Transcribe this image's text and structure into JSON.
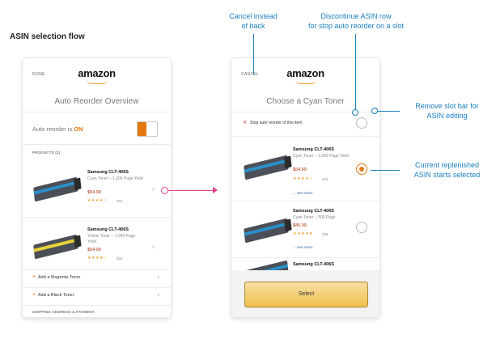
{
  "page": {
    "title": "ASIN selection flow"
  },
  "left_screen": {
    "nav_label": "DONE",
    "logo": "amazon",
    "title": "Auto Reorder Overview",
    "auto_reorder_label": "Auto reorder is",
    "auto_reorder_state": "ON",
    "products_label": "PRODUCTS (2)",
    "products": [
      {
        "name": "Samsung CLT-406S",
        "desc": "Cyan Toner – 1,000 Page Yield",
        "price": "$54.99",
        "stars": "★★★★☆",
        "reviews": "324",
        "color": "#2a8fc9"
      },
      {
        "name": "Samsung CLT-406S",
        "desc": "Yellow Toner – 1,000 Page Yield",
        "price": "$54.99",
        "stars": "★★★★☆",
        "reviews": "324",
        "color": "#e8d23a"
      }
    ],
    "add_items": [
      {
        "label": "Add a Magenta Toner"
      },
      {
        "label": "Add a Black Toner"
      }
    ],
    "shipping_label": "SHIPPING ADDRESS & PAYMENT"
  },
  "right_screen": {
    "nav_label": "CANCEL",
    "logo": "amazon",
    "title": "Choose a Cyan Toner",
    "stop_label": "Stop auto reorder of this item",
    "options": [
      {
        "name": "Samsung CLT-406S",
        "desc": "Cyan Toner – 1,000 Page Yield",
        "price": "$54.99",
        "stars": "★★★★☆",
        "reviews": "324",
        "see_more": "See More",
        "selected": true
      },
      {
        "name": "Samsung CLT-406S",
        "desc": "Cyan Toner – 500 Page",
        "price": "$45.99",
        "stars": "★★★★★",
        "reviews": "236",
        "see_more": "See More",
        "selected": false
      },
      {
        "name": "Samsung CLT-406S",
        "desc": "",
        "price": "",
        "stars": "",
        "reviews": "",
        "see_more": "",
        "selected": false
      }
    ],
    "select_label": "Select"
  },
  "callouts": {
    "cancel": "Cancel instead\nof back",
    "discontinue": "Discontinue ASIN row\nfor stop auto reorder on a slot",
    "remove_slot": "Remove slot bar for\nASIN editing",
    "current": "Current replenished\nASIN starts selected"
  },
  "colors": {
    "accent": "#e47911",
    "callout": "#1a7fc1",
    "link_arrow": "#e0418a",
    "price": "#b12704"
  }
}
